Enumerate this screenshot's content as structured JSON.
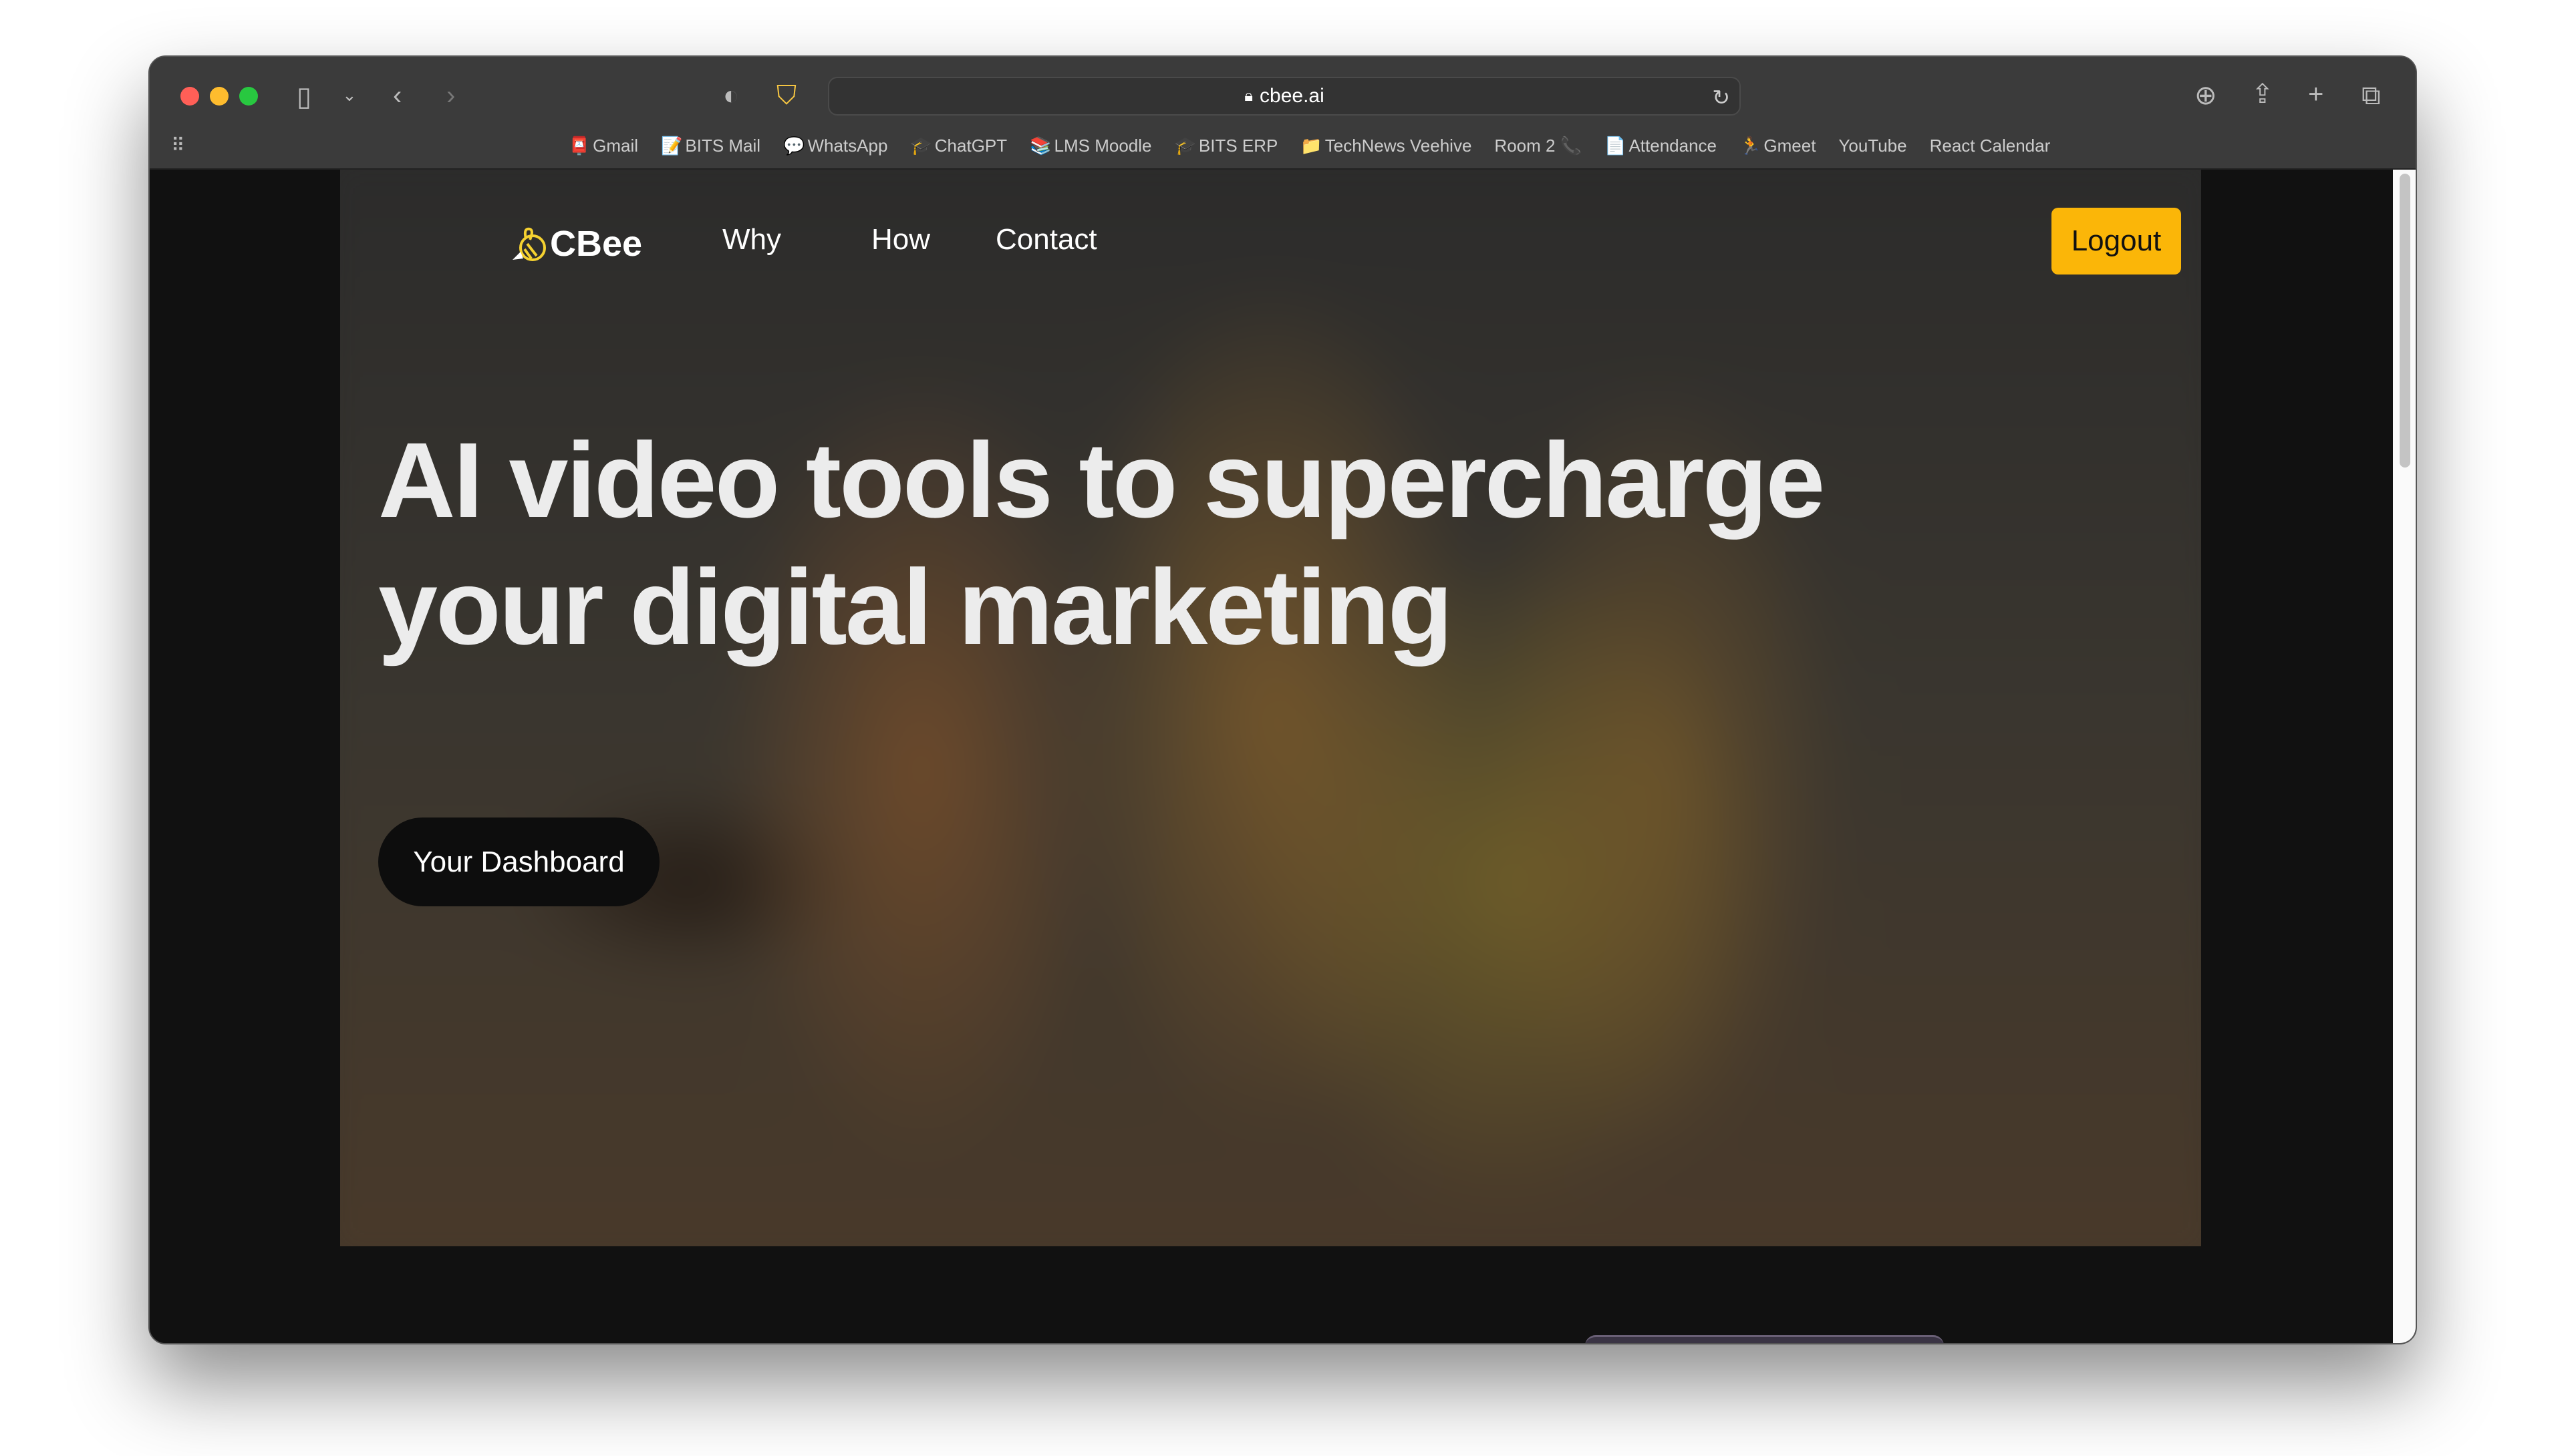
{
  "browser": {
    "url": "cbee.ai",
    "bookmarks": [
      {
        "label": "Gmail",
        "icon": "gmail-icon"
      },
      {
        "label": "BITS Mail",
        "icon": "note-icon"
      },
      {
        "label": "WhatsApp",
        "icon": "chat-icon"
      },
      {
        "label": "ChatGPT",
        "icon": "grad-cap-icon"
      },
      {
        "label": "LMS Moodle",
        "icon": "books-icon"
      },
      {
        "label": "BITS ERP",
        "icon": "grad-cap-icon"
      },
      {
        "label": "TechNews Veehive",
        "icon": "folder-icon"
      },
      {
        "label": "Room 2",
        "icon": "phone-icon"
      },
      {
        "label": "Attendance",
        "icon": "document-icon"
      },
      {
        "label": "Gmeet",
        "icon": "person-icon"
      },
      {
        "label": "YouTube",
        "icon": ""
      },
      {
        "label": "React Calendar",
        "icon": ""
      }
    ]
  },
  "page": {
    "brand": "CBee",
    "nav": [
      "Why",
      "How",
      "Contact"
    ],
    "logout": "Logout",
    "headline": "AI video tools to supercharge your digital marketing",
    "cta": "Your Dashboard",
    "colors": {
      "accent": "#fbb608",
      "brand_icon": "#f5d130"
    }
  }
}
